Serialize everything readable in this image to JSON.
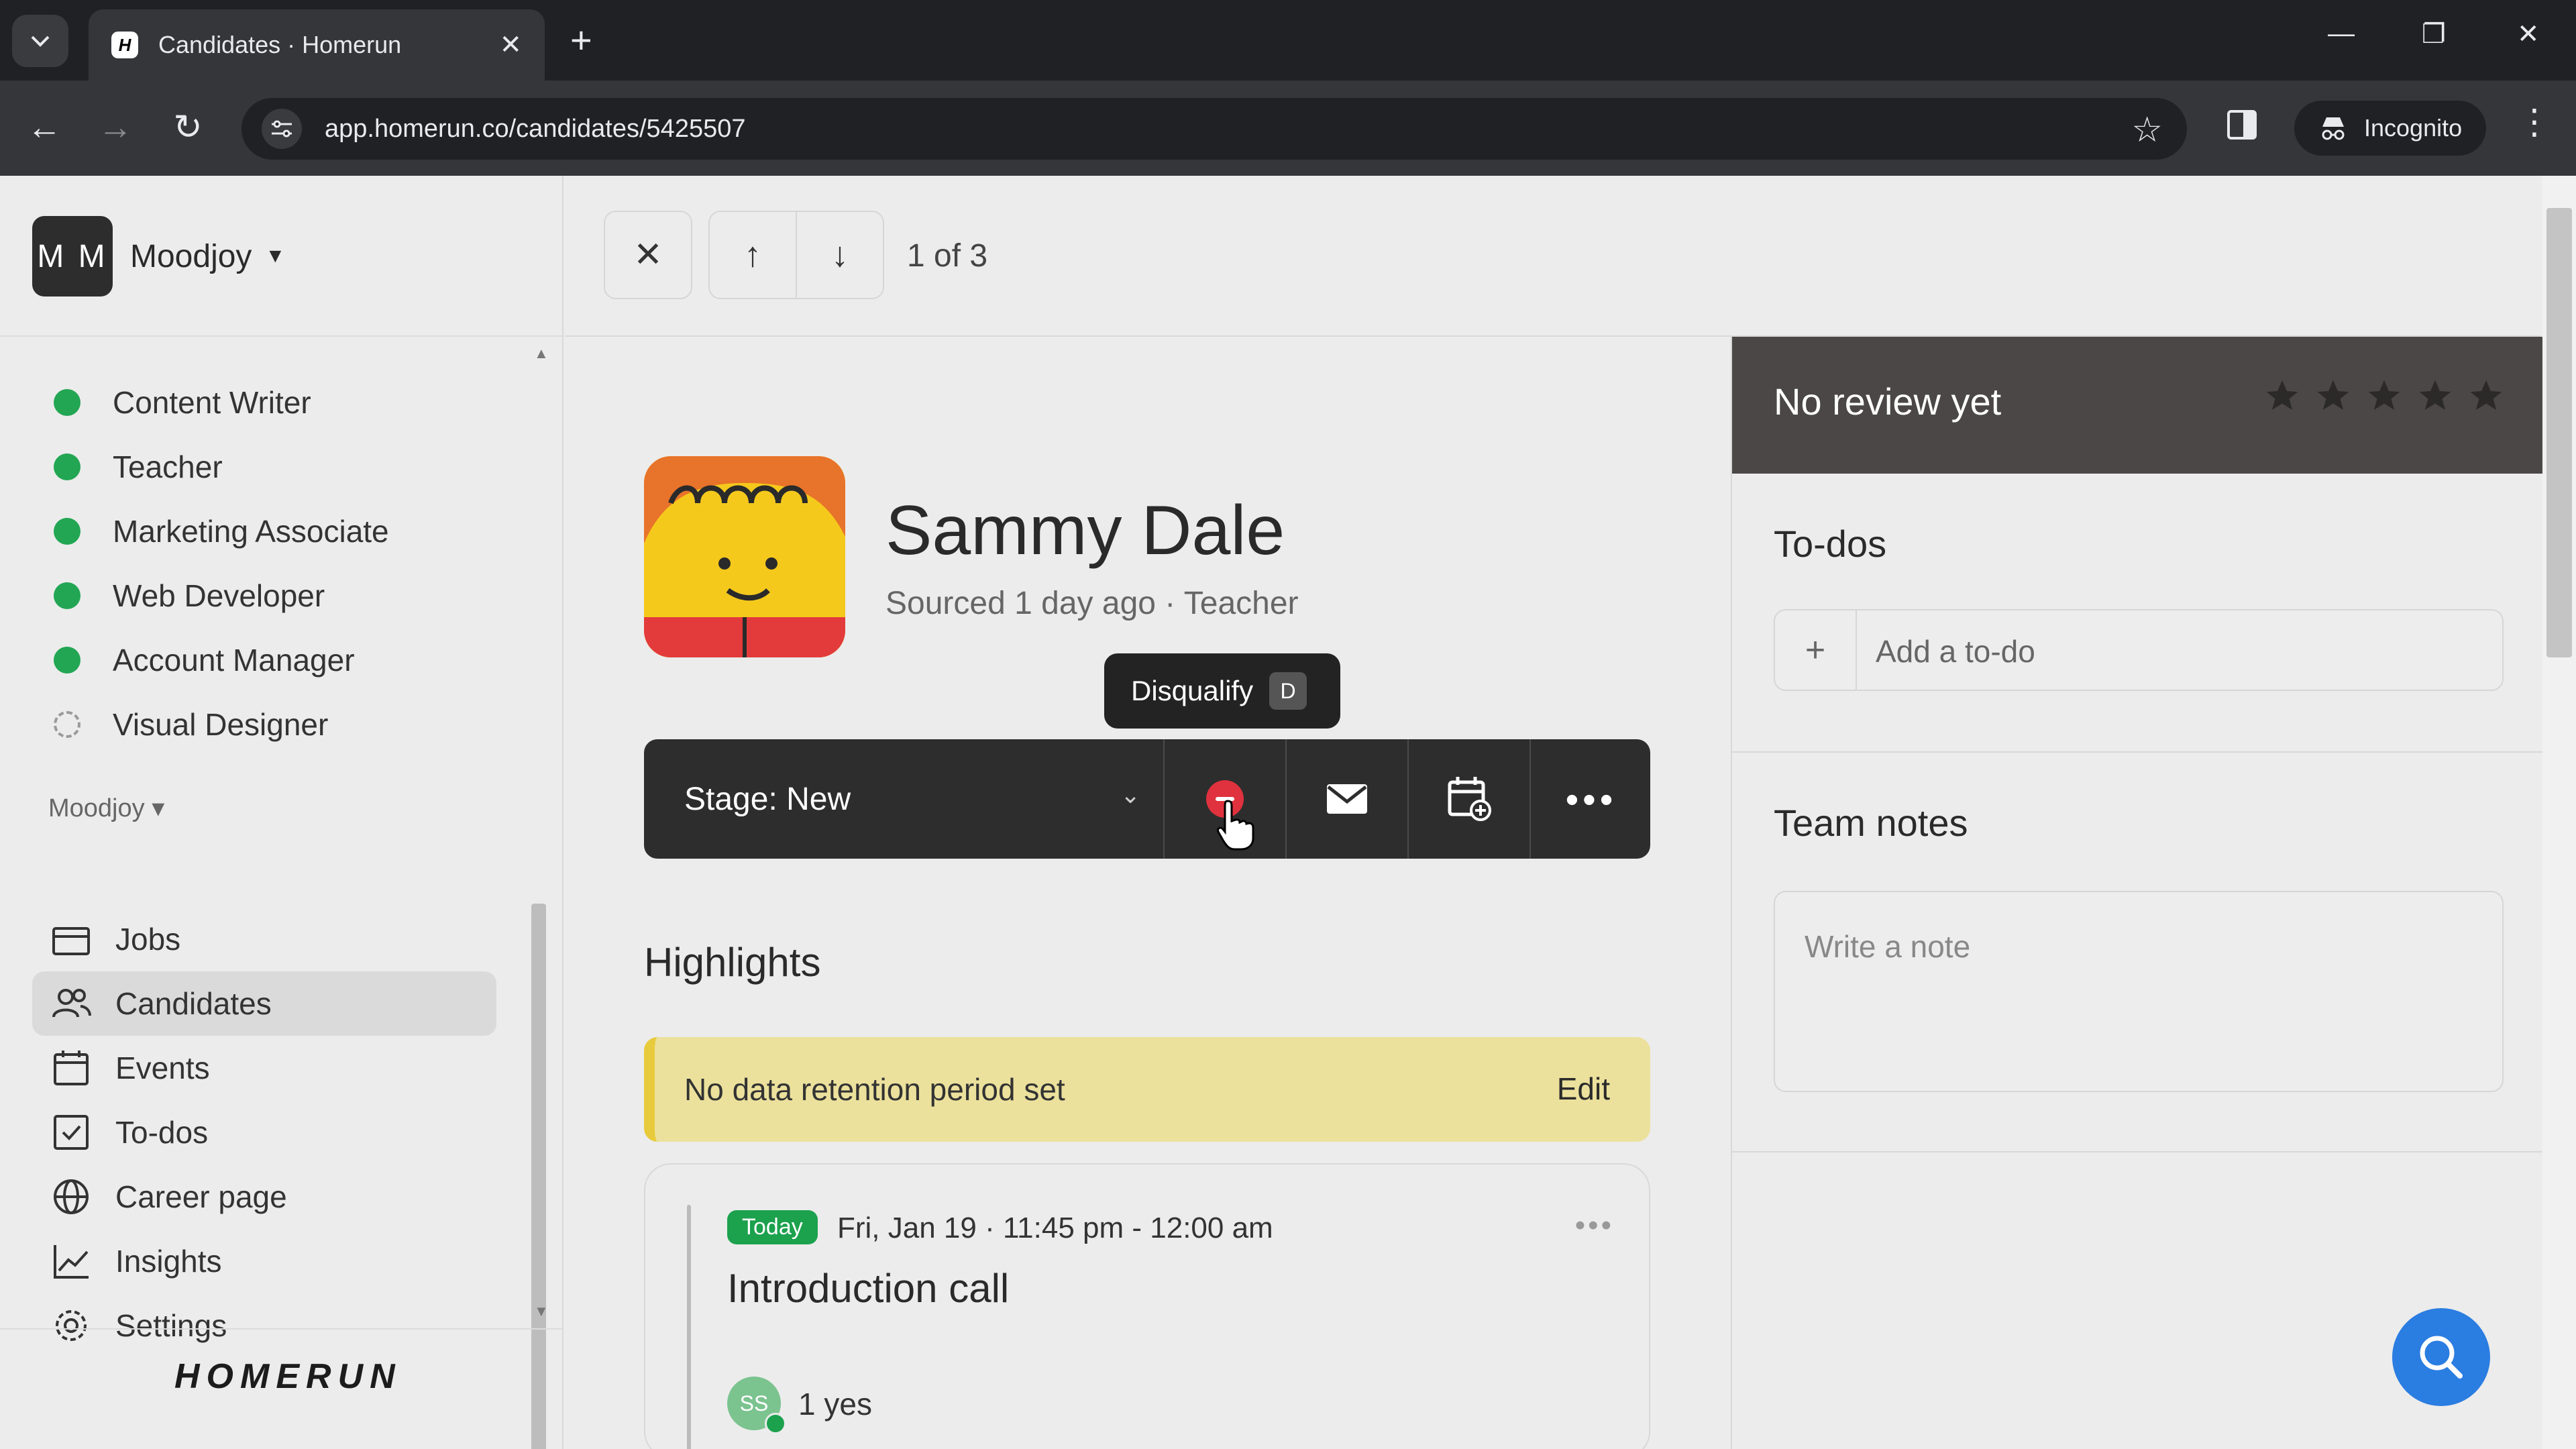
{
  "browser": {
    "tab_title": "Candidates · Homerun",
    "tab_favicon": "H",
    "url": "app.homerun.co/candidates/5425507",
    "profile_label": "Incognito"
  },
  "workspace": {
    "initials": "M M",
    "name": "Moodjoy"
  },
  "jobs": [
    {
      "label": "Content Writer",
      "status": "published"
    },
    {
      "label": "Teacher",
      "status": "published"
    },
    {
      "label": "Marketing Associate",
      "status": "published"
    },
    {
      "label": "Web Developer",
      "status": "published"
    },
    {
      "label": "Account Manager",
      "status": "published"
    },
    {
      "label": "Visual Designer",
      "status": "draft"
    }
  ],
  "nav": {
    "section_label": "Moodjoy",
    "items": [
      {
        "label": "Jobs",
        "icon": "briefcase-icon"
      },
      {
        "label": "Candidates",
        "icon": "people-icon"
      },
      {
        "label": "Events",
        "icon": "calendar-icon"
      },
      {
        "label": "To-dos",
        "icon": "checkbox-icon"
      },
      {
        "label": "Career page",
        "icon": "globe-icon"
      },
      {
        "label": "Insights",
        "icon": "chart-icon"
      },
      {
        "label": "Settings",
        "icon": "gear-icon"
      }
    ],
    "active": "Candidates"
  },
  "brand": "HOMERUN",
  "pager": {
    "text": "1 of 3"
  },
  "candidate": {
    "name": "Sammy Dale",
    "subtitle": "Sourced 1 day ago · Teacher",
    "stage_label": "Stage: New"
  },
  "tooltip": {
    "label": "Disqualify",
    "shortcut": "D"
  },
  "highlights": {
    "title": "Highlights",
    "retention_text": "No data retention period set",
    "retention_action": "Edit"
  },
  "event": {
    "badge": "Today",
    "time": "Fri, Jan 19 · 11:45 pm - 12:00 am",
    "title": "Introduction call",
    "attendee_initials": "SS",
    "rsvp": "1 yes"
  },
  "review": {
    "title": "No review yet",
    "rating": 0,
    "max_rating": 5
  },
  "todos": {
    "title": "To-dos",
    "placeholder": "Add a to-do"
  },
  "notes": {
    "title": "Team notes",
    "placeholder": "Write a note"
  },
  "colors": {
    "accent_green": "#22a653",
    "danger_red": "#e0323e",
    "retention_yellow": "#ece19c",
    "help_blue": "#2a7de1"
  }
}
